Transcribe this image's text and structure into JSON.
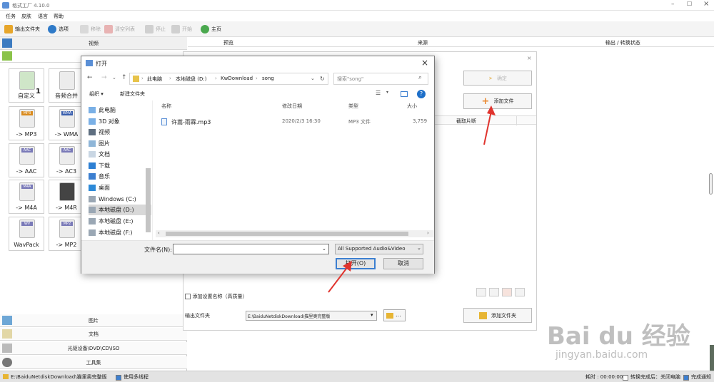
{
  "app": {
    "title": "格式工厂 4.10.0"
  },
  "menu": [
    "任务",
    "皮肤",
    "语言",
    "帮助"
  ],
  "toolbar": {
    "output_folder": "输出文件夹",
    "options": "选项",
    "remove": "移除",
    "clear_list": "清空列表",
    "stop": "停止",
    "start": "开始",
    "home": "主页"
  },
  "left": {
    "video": "视频",
    "formats": [
      {
        "label": "自定义",
        "badge": "1"
      },
      {
        "label": "音频合并",
        "badge": ""
      },
      {
        "label": "-> MP3",
        "badge": "MP3"
      },
      {
        "label": "-> WMA",
        "badge": "WMA"
      },
      {
        "label": "-> AAC",
        "badge": "AAC"
      },
      {
        "label": "-> AC3",
        "badge": "AAC"
      },
      {
        "label": "-> M4A",
        "badge": "M4A"
      },
      {
        "label": "-> M4R",
        "badge": ""
      },
      {
        "label": "WavPack",
        "badge": "WV"
      },
      {
        "label": "-> MP2",
        "badge": "MP2"
      }
    ],
    "image": "图片",
    "document": "文档",
    "rom": "光驱设备\\DVD\\CD\\ISO",
    "tools": "工具集"
  },
  "columns": {
    "preview": "预览",
    "source": "来源",
    "output_status": "输出 / 转换状态"
  },
  "panel": {
    "confirm": "确定",
    "add_file": "添加文件",
    "clip_col": "截取片断",
    "add_setting_name": "添加设置名称（高质量）",
    "output_folder_label": "输出文件夹",
    "output_path": "E:\\BaiduNetdiskDownload\\猫里奥完整版",
    "add_folder": "添加文件夹",
    "ellipsis": "..."
  },
  "dialog": {
    "title": "打开",
    "path": [
      "此电脑",
      "本地磁盘 (D:)",
      "KwDownload",
      "song"
    ],
    "search_placeholder": "搜索\"song\"",
    "organize": "组织 ▾",
    "new_folder": "新建文件夹",
    "nav": [
      "此电脑",
      "3D 对象",
      "视频",
      "图片",
      "文档",
      "下载",
      "音乐",
      "桌面",
      "Windows (C:)",
      "本地磁盘 (D:)",
      "本地磁盘 (E:)",
      "本地磁盘 (F:)"
    ],
    "headers": {
      "name": "名称",
      "date": "修改日期",
      "type": "类型",
      "size": "大小"
    },
    "files": [
      {
        "name": "许嵩-雨霖.mp3",
        "date": "2020/2/3 16:30",
        "type": "MP3 文件",
        "size": "3,759"
      }
    ],
    "filename_label": "文件名(N):",
    "filter": "All Supported Audio&Video",
    "open": "打开(O)",
    "cancel": "取消"
  },
  "status": {
    "path": "E:\\BaiduNetdiskDownload\\猫里奥完整版",
    "multithread": "使用多线程",
    "elapsed": "耗时 : 00:00:00",
    "after": "转换完成后：关闭电脑",
    "notify": "完成通知"
  },
  "colors": {
    "arrow": "#e0342e",
    "accent": "#3c7fd0"
  },
  "watermark": {
    "brand": "Bai du 经验",
    "url": "jingyan.baidu.com"
  }
}
